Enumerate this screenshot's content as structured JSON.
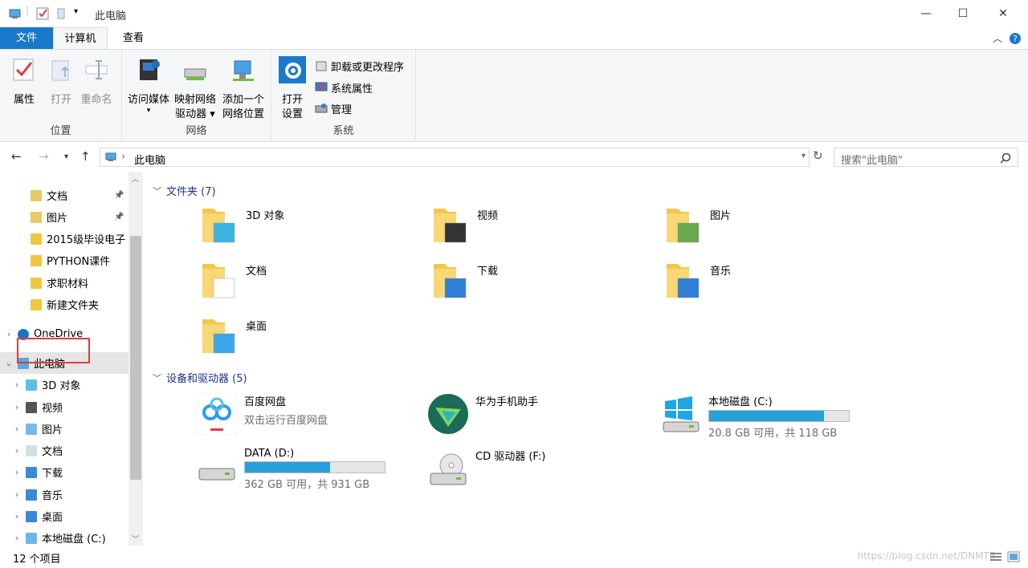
{
  "window": {
    "title": "此电脑",
    "minimize": "—",
    "maximize": "☐",
    "close": "✕"
  },
  "tabs": {
    "file": "文件",
    "computer": "计算机",
    "view": "查看"
  },
  "ribbon": {
    "location": {
      "label": "位置",
      "properties": "属性",
      "open": "打开",
      "rename": "重命名"
    },
    "network": {
      "label": "网络",
      "media": "访问媒体",
      "map_drive": "映射网络",
      "map_drive2": "驱动器",
      "add_location": "添加一个",
      "add_location2": "网络位置"
    },
    "system": {
      "label": "系统",
      "open_settings": "打开",
      "open_settings2": "设置",
      "uninstall": "卸载或更改程序",
      "sys_props": "系统属性",
      "manage": "管理"
    }
  },
  "address": {
    "path": "此电脑",
    "search_placeholder": "搜索\"此电脑\""
  },
  "sidebar": {
    "items": [
      {
        "label": "文档",
        "pinned": true
      },
      {
        "label": "图片",
        "pinned": true
      },
      {
        "label": "2015级毕设电子"
      },
      {
        "label": "PYTHON课件"
      },
      {
        "label": "求职材料"
      },
      {
        "label": "新建文件夹"
      },
      {
        "label": "OneDrive"
      },
      {
        "label": "此电脑"
      },
      {
        "label": "3D 对象"
      },
      {
        "label": "视频"
      },
      {
        "label": "图片"
      },
      {
        "label": "文档"
      },
      {
        "label": "下载"
      },
      {
        "label": "音乐"
      },
      {
        "label": "桌面"
      },
      {
        "label": "本地磁盘 (C:)"
      }
    ]
  },
  "folders_section": {
    "title": "文件夹 (7)",
    "items": [
      "3D 对象",
      "视频",
      "图片",
      "文档",
      "下载",
      "音乐",
      "桌面"
    ]
  },
  "devices_section": {
    "title": "设备和驱动器 (5)",
    "baidu": {
      "name": "百度网盘",
      "sub": "双击运行百度网盘"
    },
    "huawei": {
      "name": "华为手机助手"
    },
    "c": {
      "name": "本地磁盘 (C:)",
      "sub": "20.8 GB 可用，共 118 GB",
      "used_fraction": 0.82
    },
    "d": {
      "name": "DATA (D:)",
      "sub": "362 GB 可用，共 931 GB",
      "used_fraction": 0.61
    },
    "cd": {
      "name": "CD 驱动器 (F:)"
    }
  },
  "status": {
    "count": "12 个项目",
    "watermark": "https://blog.csdn.net/DNMTB"
  },
  "colors": {
    "accent": "#1979ca",
    "bar": "#26a0da",
    "red": "#e03c3c"
  }
}
